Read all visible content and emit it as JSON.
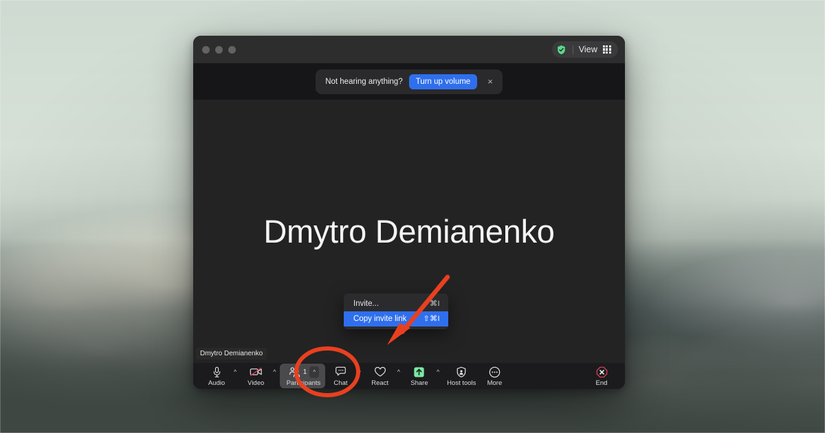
{
  "window": {
    "titlebar": {
      "traffic_lights": [
        "close",
        "minimize",
        "maximize"
      ],
      "shield_icon": "green-shield-check-icon",
      "view_label": "View",
      "grid_icon": "grid-layout-icon"
    }
  },
  "banner": {
    "message": "Not hearing anything?",
    "action_label": "Turn up volume",
    "close_label": "×"
  },
  "stage": {
    "participant_name": "Dmytro Demianenko",
    "name_chip": "Dmytro Demianenko"
  },
  "invite_menu": {
    "items": [
      {
        "label": "Invite...",
        "shortcut": "⌘I",
        "selected": false
      },
      {
        "label": "Copy invite link",
        "shortcut": "⇧⌘I",
        "selected": true
      }
    ]
  },
  "toolbar": {
    "buttons": [
      {
        "label": "Audio",
        "icon": "microphone-icon",
        "caret": true,
        "count": null,
        "active": false
      },
      {
        "label": "Video",
        "icon": "camera-off-icon",
        "caret": true,
        "count": null,
        "active": false
      },
      {
        "label": "Participants",
        "icon": "participants-icon",
        "caret": true,
        "count": "1",
        "active": true
      },
      {
        "label": "Chat",
        "icon": "chat-bubble-icon",
        "caret": true,
        "count": null,
        "active": false
      },
      {
        "label": "React",
        "icon": "heart-icon",
        "caret": true,
        "count": null,
        "active": false
      },
      {
        "label": "Share",
        "icon": "share-screen-icon",
        "caret": true,
        "count": null,
        "active": false
      },
      {
        "label": "Host tools",
        "icon": "shield-host-tools-icon",
        "caret": false,
        "count": null,
        "active": false
      },
      {
        "label": "More",
        "icon": "more-ellipsis-icon",
        "caret": false,
        "count": null,
        "active": false
      },
      {
        "label": "End",
        "icon": "end-call-icon",
        "caret": false,
        "count": null,
        "active": false
      }
    ]
  },
  "annotation": {
    "arrow": "red-arrow-pointer",
    "highlight": "red-ellipse-highlight",
    "color": "#E8401F"
  },
  "colors": {
    "accent_blue": "#2F6FED",
    "annotation_red": "#E8401F",
    "share_green": "#7CE8A4",
    "end_red": "#E8415C"
  }
}
